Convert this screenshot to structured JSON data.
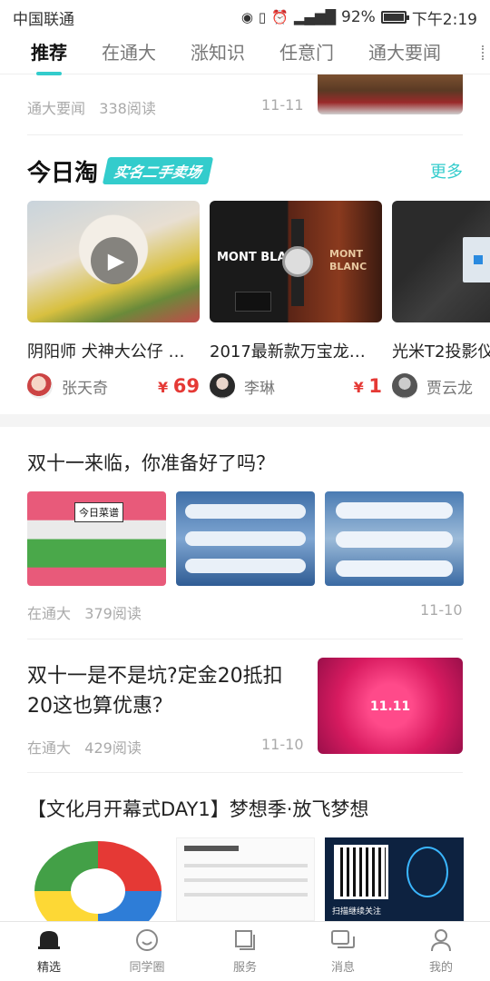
{
  "status": {
    "carrier": "中国联通",
    "battery": "92%",
    "time": "下午2:19"
  },
  "tabs": [
    "推荐",
    "在通大",
    "涨知识",
    "任意门",
    "通大要闻"
  ],
  "top_item": {
    "source": "通大要闻",
    "reads": "338阅读",
    "date": "11-11"
  },
  "taobao": {
    "title": "今日淘",
    "badge": "实名二手卖场",
    "more": "更多",
    "cards": [
      {
        "title": "阴阳师 犬神大公仔 …",
        "seller": "张天奇",
        "currency": "¥",
        "price": "69"
      },
      {
        "title": "2017最新款万宝龙…",
        "seller": "李琳",
        "currency": "¥",
        "price": "1"
      },
      {
        "title": "光米T2投影仪",
        "seller": "贾云龙",
        "currency": "",
        "price": ""
      }
    ]
  },
  "articles": [
    {
      "title": "双十一来临，你准备好了吗？",
      "source": "在通大",
      "reads": "379阅读",
      "date": "11-10"
    },
    {
      "title": "双十一是不是坑?定金20抵扣20这也算优惠？",
      "source": "在通大",
      "reads": "429阅读",
      "date": "11-10"
    },
    {
      "title": "【文化月开幕式DAY1】梦想季·放飞梦想"
    }
  ],
  "image_texts": {
    "card1_brand": "MONT BLANC",
    "card1_box": "MONT BLANC",
    "art1_img1": "今日菜谱",
    "art2_thumb": "11.11",
    "art3_img3": "扫描继续关注"
  },
  "nav": [
    "精选",
    "同学圈",
    "服务",
    "消息",
    "我的"
  ],
  "colors": {
    "accent": "#33cccc",
    "price": "#e53935"
  }
}
